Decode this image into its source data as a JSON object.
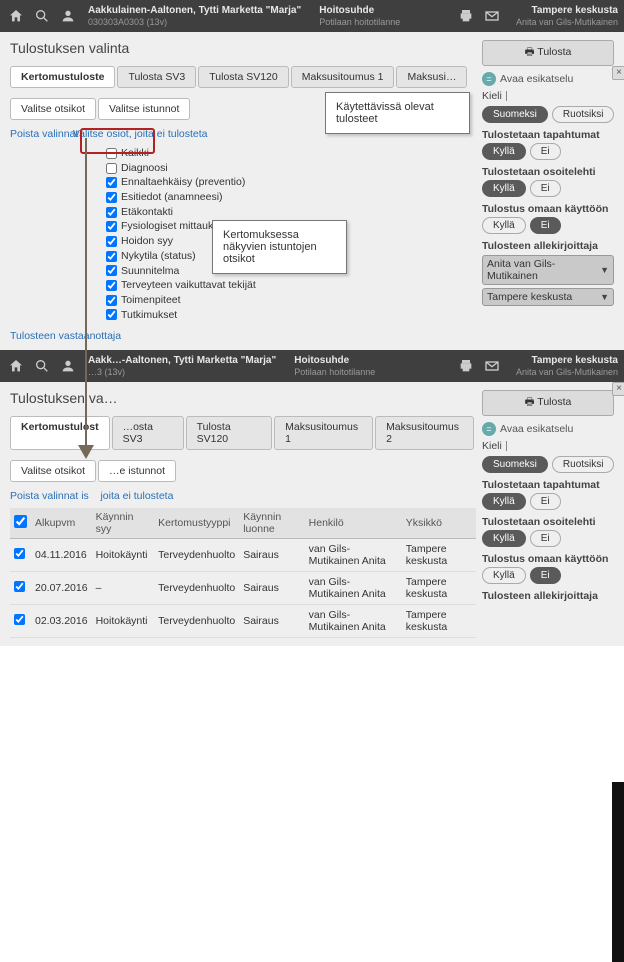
{
  "topbar": {
    "user_name": "Aakkulainen-Aaltonen, Tytti Marketta \"Marja\"",
    "user_sub": "030303A0303 (13v)",
    "rel_title": "Hoitosuhde",
    "rel_sub": "Potilaan hoitotilanne",
    "org_name": "Tampere keskusta",
    "org_sub": "Anita van Gils-Mutikainen"
  },
  "page": {
    "title": "Tulostuksen valinta",
    "tabs": [
      "Kertomustuloste",
      "Tulosta SV3",
      "Tulosta SV120",
      "Maksusitoumus 1",
      "Maksusitoumus 2"
    ],
    "sub_tabs": [
      "Valitse otsikot",
      "Valitse istunnot"
    ],
    "link1": "Poista valinnat",
    "link2": "Valitse osiot, joita ei tulosteta",
    "checks": [
      "Kaikki",
      "Diagnoosi",
      "Ennaltaehkäisy (preventio)",
      "Esitiedot (anamneesi)",
      "Etäkontakti",
      "Fysiologiset mittaukset",
      "Hoidon syy",
      "Nykytila (status)",
      "Suunnitelma",
      "Terveyteen vaikuttavat tekijät",
      "Toimenpiteet",
      "Tutkimukset"
    ],
    "checked": [
      false,
      false,
      true,
      true,
      true,
      true,
      true,
      true,
      true,
      true,
      true,
      true
    ],
    "bottom_text": "Tulosteen vastaanottaja"
  },
  "callouts": {
    "c1": "Käytettävissä olevat tulosteet",
    "c2": "Kertomuksessa näkyvien istuntojen otsikot"
  },
  "right": {
    "print_btn": "Tulosta",
    "preview": "Avaa esikatselu",
    "lang_label": "Kieli",
    "lang_opts": [
      "Suomeksi",
      "Ruotsiksi"
    ],
    "lang_active": 0,
    "sec1": "Tulostetaan tapahtumat",
    "sec2": "Tulostetaan osoitelehti",
    "sec3": "Tulostus omaan käyttöön",
    "sec4": "Tulosteen allekirjoittaja",
    "yes": "Kyllä",
    "no": "Ei",
    "signer1": "Anita van Gils-Mutikainen",
    "signer2": "Tampere keskusta"
  },
  "link2b": "Valitse osiot, joita ei tulosteta",
  "table": {
    "headers": [
      "Alkupvm",
      "Käynnin syy",
      "Kertomustyyppi",
      "Käynnin luonne",
      "Henkilö",
      "Yksikkö"
    ],
    "rows": [
      [
        "04.11.2016",
        "Hoitokäynti",
        "Terveydenhuolto",
        "Sairaus",
        "van Gils-Mutikainen Anita",
        "Tampere keskusta"
      ],
      [
        "20.07.2016",
        "–",
        "Terveydenhuolto",
        "Sairaus",
        "van Gils-Mutikainen Anita",
        "Tampere keskusta"
      ],
      [
        "02.03.2016",
        "Hoitokäynti",
        "Terveydenhuolto",
        "Sairaus",
        "van Gils-Mutikainen Anita",
        "Tampere keskusta"
      ]
    ]
  }
}
